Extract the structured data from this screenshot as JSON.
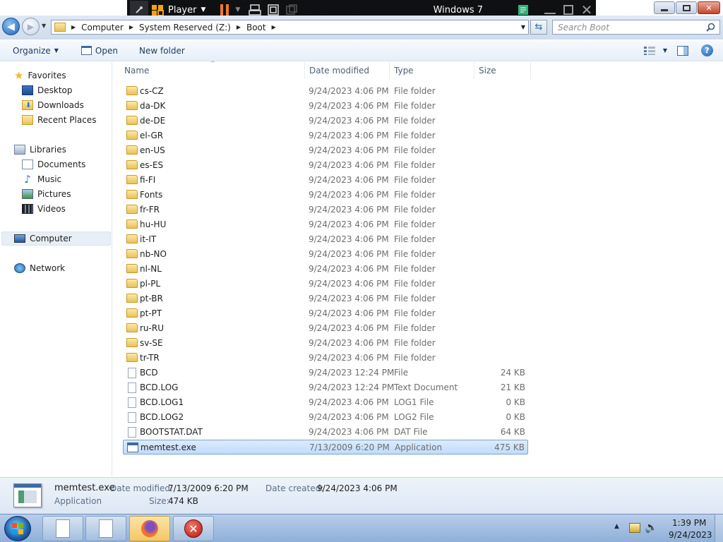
{
  "vm_player": {
    "menu_label": "Player",
    "vm_name": "Windows 7"
  },
  "window": {
    "caption_buttons": [
      "minimize",
      "maximize",
      "close"
    ]
  },
  "address_bar": {
    "breadcrumbs": [
      "Computer",
      "System Reserved (Z:)",
      "Boot"
    ],
    "search_placeholder": "Search Boot"
  },
  "command_bar": {
    "organize_label": "Organize",
    "open_label": "Open",
    "new_folder_label": "New folder"
  },
  "nav_pane": {
    "favorites": {
      "label": "Favorites",
      "items": [
        "Desktop",
        "Downloads",
        "Recent Places"
      ]
    },
    "libraries": {
      "label": "Libraries",
      "items": [
        "Documents",
        "Music",
        "Pictures",
        "Videos"
      ]
    },
    "computer_label": "Computer",
    "network_label": "Network"
  },
  "columns": {
    "name": "Name",
    "date_modified": "Date modified",
    "type": "Type",
    "size": "Size"
  },
  "files": [
    {
      "name": "cs-CZ",
      "date": "9/24/2023 4:06 PM",
      "type": "File folder",
      "size": "",
      "icon": "folder"
    },
    {
      "name": "da-DK",
      "date": "9/24/2023 4:06 PM",
      "type": "File folder",
      "size": "",
      "icon": "folder"
    },
    {
      "name": "de-DE",
      "date": "9/24/2023 4:06 PM",
      "type": "File folder",
      "size": "",
      "icon": "folder"
    },
    {
      "name": "el-GR",
      "date": "9/24/2023 4:06 PM",
      "type": "File folder",
      "size": "",
      "icon": "folder"
    },
    {
      "name": "en-US",
      "date": "9/24/2023 4:06 PM",
      "type": "File folder",
      "size": "",
      "icon": "folder"
    },
    {
      "name": "es-ES",
      "date": "9/24/2023 4:06 PM",
      "type": "File folder",
      "size": "",
      "icon": "folder"
    },
    {
      "name": "fi-FI",
      "date": "9/24/2023 4:06 PM",
      "type": "File folder",
      "size": "",
      "icon": "folder"
    },
    {
      "name": "Fonts",
      "date": "9/24/2023 4:06 PM",
      "type": "File folder",
      "size": "",
      "icon": "folder"
    },
    {
      "name": "fr-FR",
      "date": "9/24/2023 4:06 PM",
      "type": "File folder",
      "size": "",
      "icon": "folder"
    },
    {
      "name": "hu-HU",
      "date": "9/24/2023 4:06 PM",
      "type": "File folder",
      "size": "",
      "icon": "folder"
    },
    {
      "name": "it-IT",
      "date": "9/24/2023 4:06 PM",
      "type": "File folder",
      "size": "",
      "icon": "folder"
    },
    {
      "name": "nb-NO",
      "date": "9/24/2023 4:06 PM",
      "type": "File folder",
      "size": "",
      "icon": "folder"
    },
    {
      "name": "nl-NL",
      "date": "9/24/2023 4:06 PM",
      "type": "File folder",
      "size": "",
      "icon": "folder"
    },
    {
      "name": "pl-PL",
      "date": "9/24/2023 4:06 PM",
      "type": "File folder",
      "size": "",
      "icon": "folder"
    },
    {
      "name": "pt-BR",
      "date": "9/24/2023 4:06 PM",
      "type": "File folder",
      "size": "",
      "icon": "folder"
    },
    {
      "name": "pt-PT",
      "date": "9/24/2023 4:06 PM",
      "type": "File folder",
      "size": "",
      "icon": "folder"
    },
    {
      "name": "ru-RU",
      "date": "9/24/2023 4:06 PM",
      "type": "File folder",
      "size": "",
      "icon": "folder"
    },
    {
      "name": "sv-SE",
      "date": "9/24/2023 4:06 PM",
      "type": "File folder",
      "size": "",
      "icon": "folder"
    },
    {
      "name": "tr-TR",
      "date": "9/24/2023 4:06 PM",
      "type": "File folder",
      "size": "",
      "icon": "folder"
    },
    {
      "name": "BCD",
      "date": "9/24/2023 12:24 PM",
      "type": "File",
      "size": "24 KB",
      "icon": "file"
    },
    {
      "name": "BCD.LOG",
      "date": "9/24/2023 12:24 PM",
      "type": "Text Document",
      "size": "21 KB",
      "icon": "file"
    },
    {
      "name": "BCD.LOG1",
      "date": "9/24/2023 4:06 PM",
      "type": "LOG1 File",
      "size": "0 KB",
      "icon": "file"
    },
    {
      "name": "BCD.LOG2",
      "date": "9/24/2023 4:06 PM",
      "type": "LOG2 File",
      "size": "0 KB",
      "icon": "file"
    },
    {
      "name": "BOOTSTAT.DAT",
      "date": "9/24/2023 4:06 PM",
      "type": "DAT File",
      "size": "64 KB",
      "icon": "file"
    },
    {
      "name": "memtest.exe",
      "date": "7/13/2009 6:20 PM",
      "type": "Application",
      "size": "475 KB",
      "icon": "exe",
      "selected": true
    }
  ],
  "details_pane": {
    "name": "memtest.exe",
    "type": "Application",
    "date_modified_label": "Date modified:",
    "date_modified": "7/13/2009 6:20 PM",
    "date_created_label": "Date created:",
    "date_created": "9/24/2023 4:06 PM",
    "size_label": "Size:",
    "size": "474 KB"
  },
  "taskbar": {
    "time": "1:39 PM",
    "date": "9/24/2023",
    "buttons": [
      "start-orb",
      "explorer-window-1",
      "explorer-window-2",
      "firefox",
      "error-app"
    ]
  },
  "colors": {
    "selection": "#cce4fc",
    "selection_border": "#7da2ce",
    "taskbar": "#9fbce0",
    "vm_bar": "#0f1012"
  }
}
